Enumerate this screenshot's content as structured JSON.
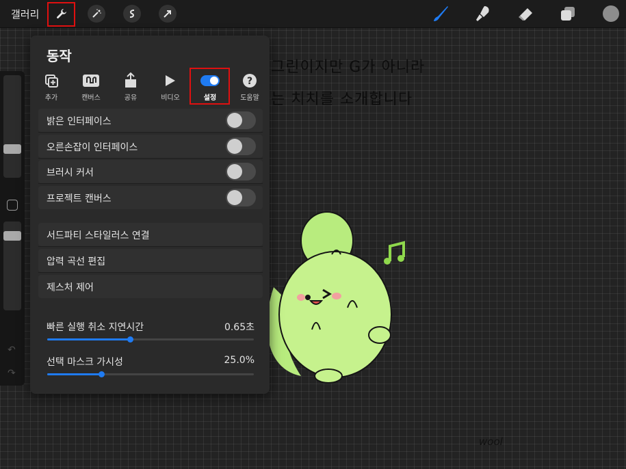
{
  "topbar": {
    "gallery_label": "갤러리",
    "left_tools": [
      "wrench-icon",
      "magic-wand-icon",
      "selection-s-icon",
      "arrow-icon"
    ],
    "right_tools": [
      "brush-icon",
      "smudge-icon",
      "eraser-icon",
      "layers-icon"
    ],
    "accent": "#1f7bf2",
    "current_color": "#8d8d8d"
  },
  "canvas": {
    "line1": "그린이지만 G가 아니라",
    "line2": "는 치치를 소개합니다",
    "signature": "wool"
  },
  "panel": {
    "title": "동작",
    "tabs": [
      {
        "label": "추가",
        "icon": "add-icon"
      },
      {
        "label": "캔버스",
        "icon": "canvas-icon"
      },
      {
        "label": "공유",
        "icon": "share-icon"
      },
      {
        "label": "비디오",
        "icon": "play-icon"
      },
      {
        "label": "설정",
        "icon": "toggle-icon",
        "active": true
      },
      {
        "label": "도움말",
        "icon": "help-icon"
      }
    ],
    "toggles": [
      {
        "label": "밝은 인터페이스",
        "on": false
      },
      {
        "label": "오른손잡이 인터페이스",
        "on": false
      },
      {
        "label": "브러시 커서",
        "on": false
      },
      {
        "label": "프로젝트 캔버스",
        "on": false
      }
    ],
    "links": [
      {
        "label": "서드파티 스타일러스 연결"
      },
      {
        "label": "압력 곡선 편집"
      },
      {
        "label": "제스처 제어"
      }
    ],
    "sliders": [
      {
        "label": "빠른 실행 취소 지연시간",
        "value": "0.65초",
        "fraction": 0.4
      },
      {
        "label": "선택 마스크 가시성",
        "value": "25.0%",
        "fraction": 0.26
      }
    ]
  }
}
